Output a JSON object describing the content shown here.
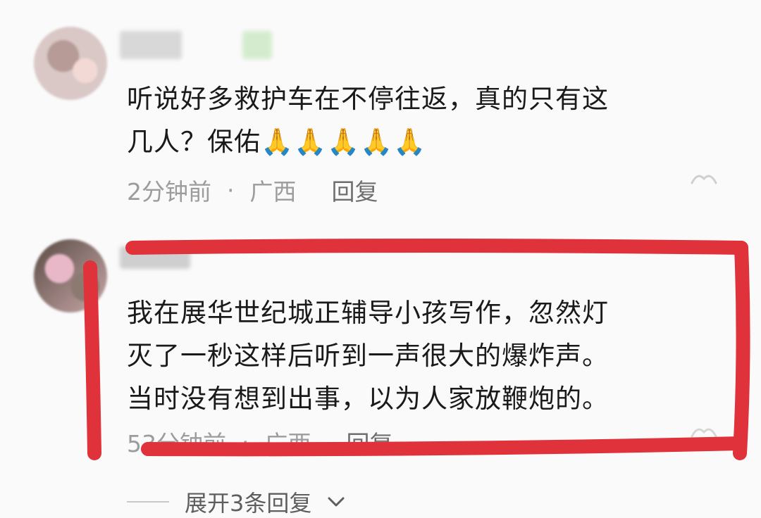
{
  "comments": [
    {
      "text_line1": "听说好多救护车在不停往返，真的只有这",
      "text_line2": "几人？保佑🙏🙏🙏🙏🙏",
      "time": "2分钟前",
      "separator": "·",
      "location": "广西",
      "reply_label": "回复"
    },
    {
      "text_line1": "我在展华世纪城正辅导小孩写作，忽然灯",
      "text_line2": "灭了一秒这样后听到一声很大的爆炸声。",
      "text_line3": "当时没有想到出事，以为人家放鞭炮的。",
      "time": "53分钟前",
      "separator": "·",
      "location": "广西",
      "reply_label": "回复"
    }
  ],
  "expand_replies": {
    "label": "展开3条回复"
  },
  "icons": {
    "like": "thumb-like-icon",
    "chevron": "chevron-down-icon"
  },
  "annotation_color": "#e0323a"
}
